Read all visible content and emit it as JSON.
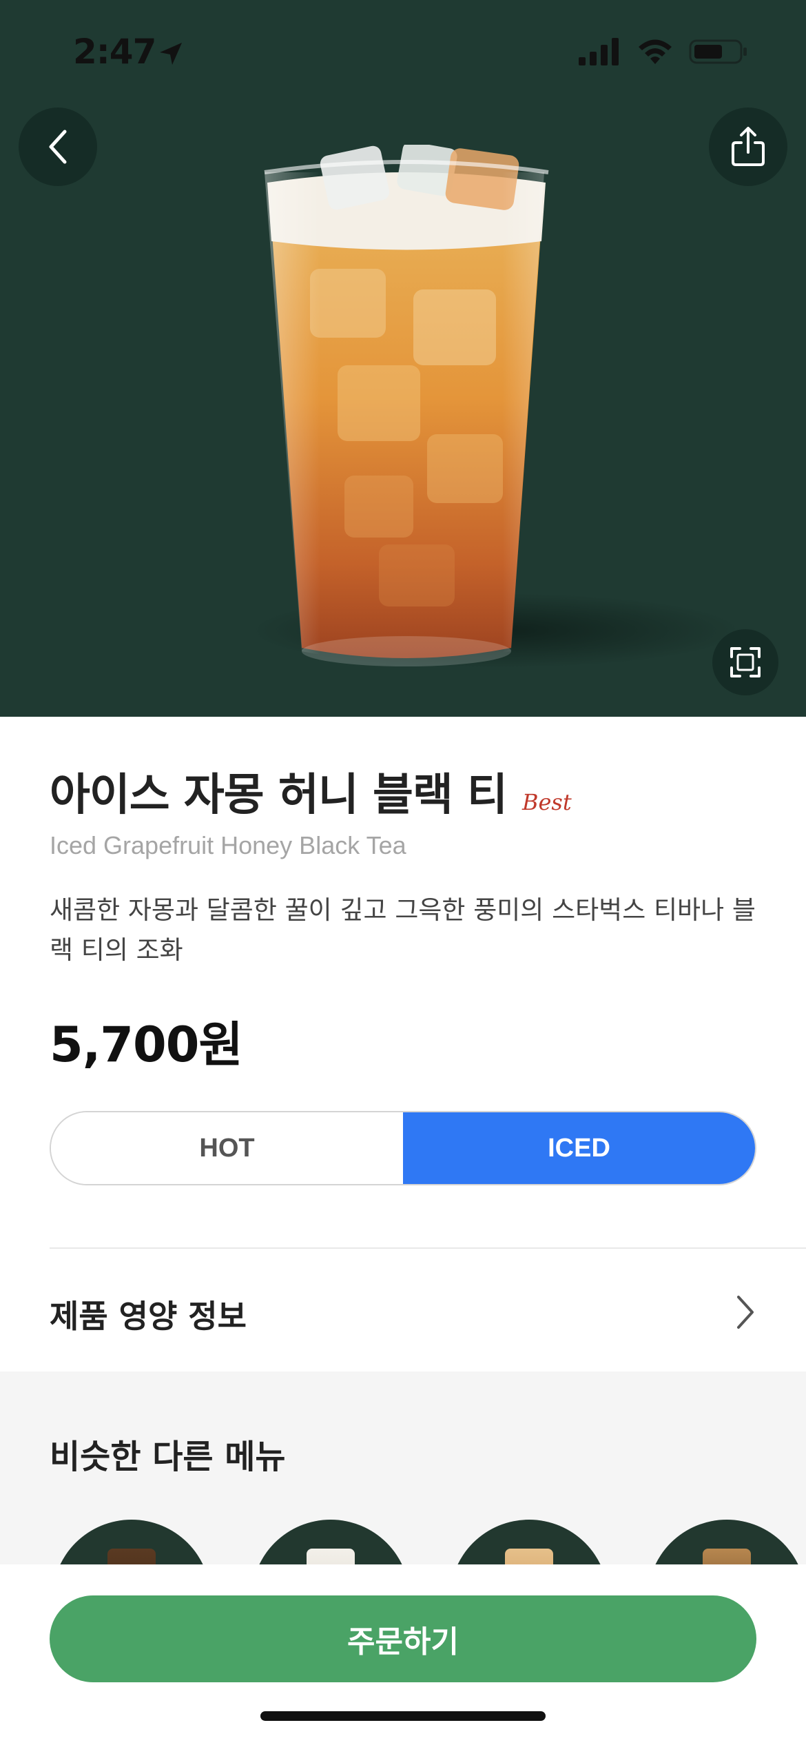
{
  "status_bar": {
    "time": "2:47",
    "icons": [
      "location-arrow-icon",
      "signal-icon",
      "wifi-icon",
      "battery-icon"
    ]
  },
  "hero": {
    "background_color": "#1f3a32",
    "back_icon": "chevron-left-icon",
    "share_icon": "share-icon",
    "expand_icon": "expand-icon"
  },
  "product": {
    "name_ko": "아이스 자몽 허니 블랙 티",
    "badge": "Best",
    "name_en": "Iced Grapefruit Honey Black Tea",
    "description": "새콤한 자몽과 달콤한 꿀이 깊고 그윽한 풍미의 스타벅스 티바나 블랙 티의 조화",
    "price": "5,700원"
  },
  "temperature": {
    "options": [
      "HOT",
      "ICED"
    ],
    "selected": "ICED",
    "accent_color": "#2f78f4"
  },
  "nutrition": {
    "label": "제품 영양 정보",
    "icon": "chevron-right-icon"
  },
  "similar": {
    "title": "비슷한 다른 메뉴"
  },
  "order": {
    "label": "주문하기",
    "color": "#4aa366"
  }
}
